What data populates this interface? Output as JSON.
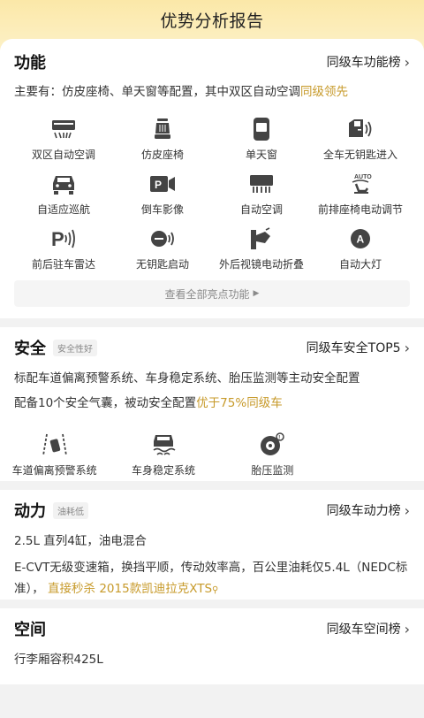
{
  "page_title": "优势分析报告",
  "function": {
    "title": "功能",
    "rank_label": "同级车功能榜",
    "desc_main": "主要有：仿皮座椅、单天窗等配置，其中双区自动空调",
    "desc_highlight": "同级领先",
    "features": [
      {
        "label": "双区自动空调",
        "icon": "dual-zone-ac-icon"
      },
      {
        "label": "仿皮座椅",
        "icon": "leather-seat-icon"
      },
      {
        "label": "单天窗",
        "icon": "sunroof-icon"
      },
      {
        "label": "全车无钥匙进入",
        "icon": "keyless-entry-icon"
      },
      {
        "label": "自适应巡航",
        "icon": "adaptive-cruise-icon"
      },
      {
        "label": "倒车影像",
        "icon": "reverse-camera-icon"
      },
      {
        "label": "自动空调",
        "icon": "auto-ac-icon"
      },
      {
        "label": "前排座椅电动调节",
        "icon": "power-seat-icon"
      },
      {
        "label": "前后驻车雷达",
        "icon": "parking-radar-icon"
      },
      {
        "label": "无钥匙启动",
        "icon": "keyless-start-icon"
      },
      {
        "label": "外后视镜电动折叠",
        "icon": "mirror-fold-icon"
      },
      {
        "label": "自动大灯",
        "icon": "auto-headlight-icon"
      }
    ],
    "more_label": "查看全部亮点功能"
  },
  "safety": {
    "title": "安全",
    "tag": "安全性好",
    "rank_label": "同级车安全TOP5",
    "desc1": "标配车道偏离预警系统、车身稳定系统、胎压监测等主动安全配置",
    "desc2_main": "配备10个安全气囊，被动安全配置",
    "desc2_highlight": "优于75%同级车",
    "features": [
      {
        "label": "车道偏离预警系统",
        "icon": "lane-departure-icon"
      },
      {
        "label": "车身稳定系统",
        "icon": "stability-control-icon"
      },
      {
        "label": "胎压监测",
        "icon": "tire-pressure-icon"
      }
    ]
  },
  "power": {
    "title": "动力",
    "tag": "油耗低",
    "rank_label": "同级车动力榜",
    "engine": "2.5L 直列4缸，油电混合",
    "trans_line1": "E-CVT无级变速箱，换挡平顺，传动效率高，百公里油耗仅5.4L（NEDC标",
    "trans_line2_main": "准），",
    "trans_line2_highlight": "直接秒杀 2015款凯迪拉克XTS"
  },
  "space": {
    "title": "空间",
    "rank_label": "同级车空间榜",
    "desc": "行李厢容积425L"
  },
  "colors": {
    "accent": "#c79a2a",
    "header_bg": "#fbe8a8"
  }
}
